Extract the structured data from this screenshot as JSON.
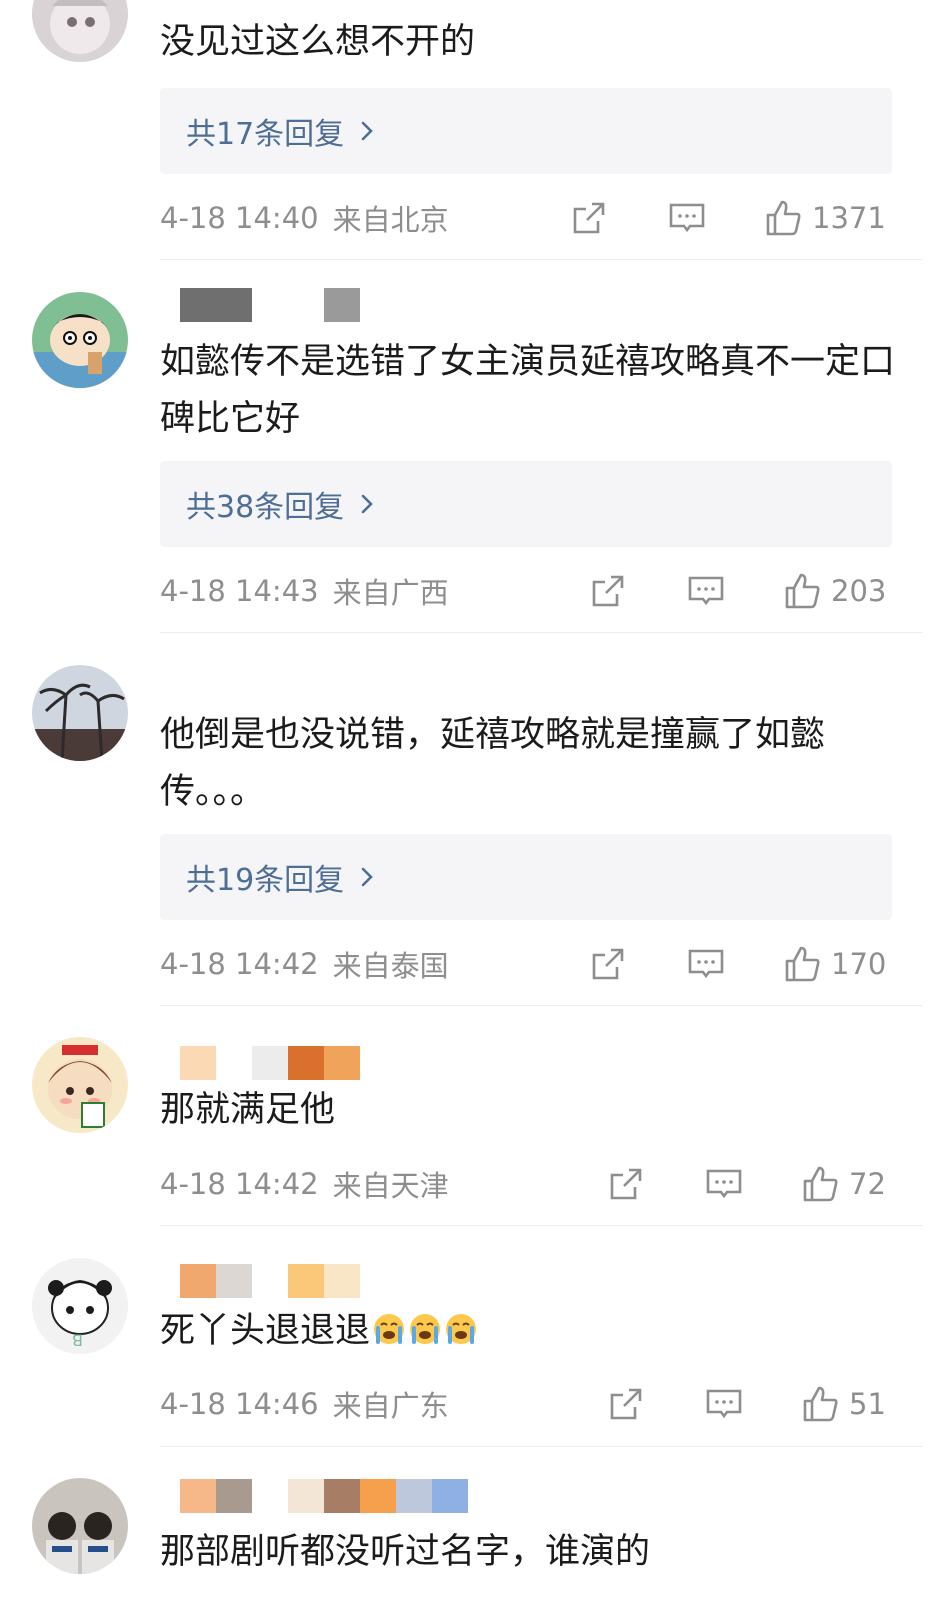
{
  "comments": [
    {
      "text": "没见过这么想不开的",
      "replies": "共17条回复",
      "time": "4-18 14:40",
      "location": "来自北京",
      "likes": "1371"
    },
    {
      "text": "如懿传不是选错了女主演员延禧攻略真不一定口碑比它好",
      "replies": "共38条回复",
      "time": "4-18 14:43",
      "location": "来自广西",
      "likes": "203"
    },
    {
      "text": "他倒是也没说错，延禧攻略就是撞赢了如懿传。。。",
      "replies": "共19条回复",
      "time": "4-18 14:42",
      "location": "来自泰国",
      "likes": "170"
    },
    {
      "text": "那就满足他",
      "time": "4-18 14:42",
      "location": "来自天津",
      "likes": "72"
    },
    {
      "text": "死丫头退退退",
      "emoji": "crying-face-emoji",
      "time": "4-18 14:46",
      "location": "来自广东",
      "likes": "51"
    },
    {
      "text": "那部剧听都没听过名字，谁演的"
    }
  ],
  "icons": {
    "share": "share-icon",
    "comment": "comment-icon",
    "like": "thumbs-up-icon",
    "chevron": "chevron-right-icon"
  },
  "colors": {
    "reply_link": "#4f6e95",
    "meta_gray": "#8e8e8e",
    "reply_box": "#f5f5f7"
  }
}
